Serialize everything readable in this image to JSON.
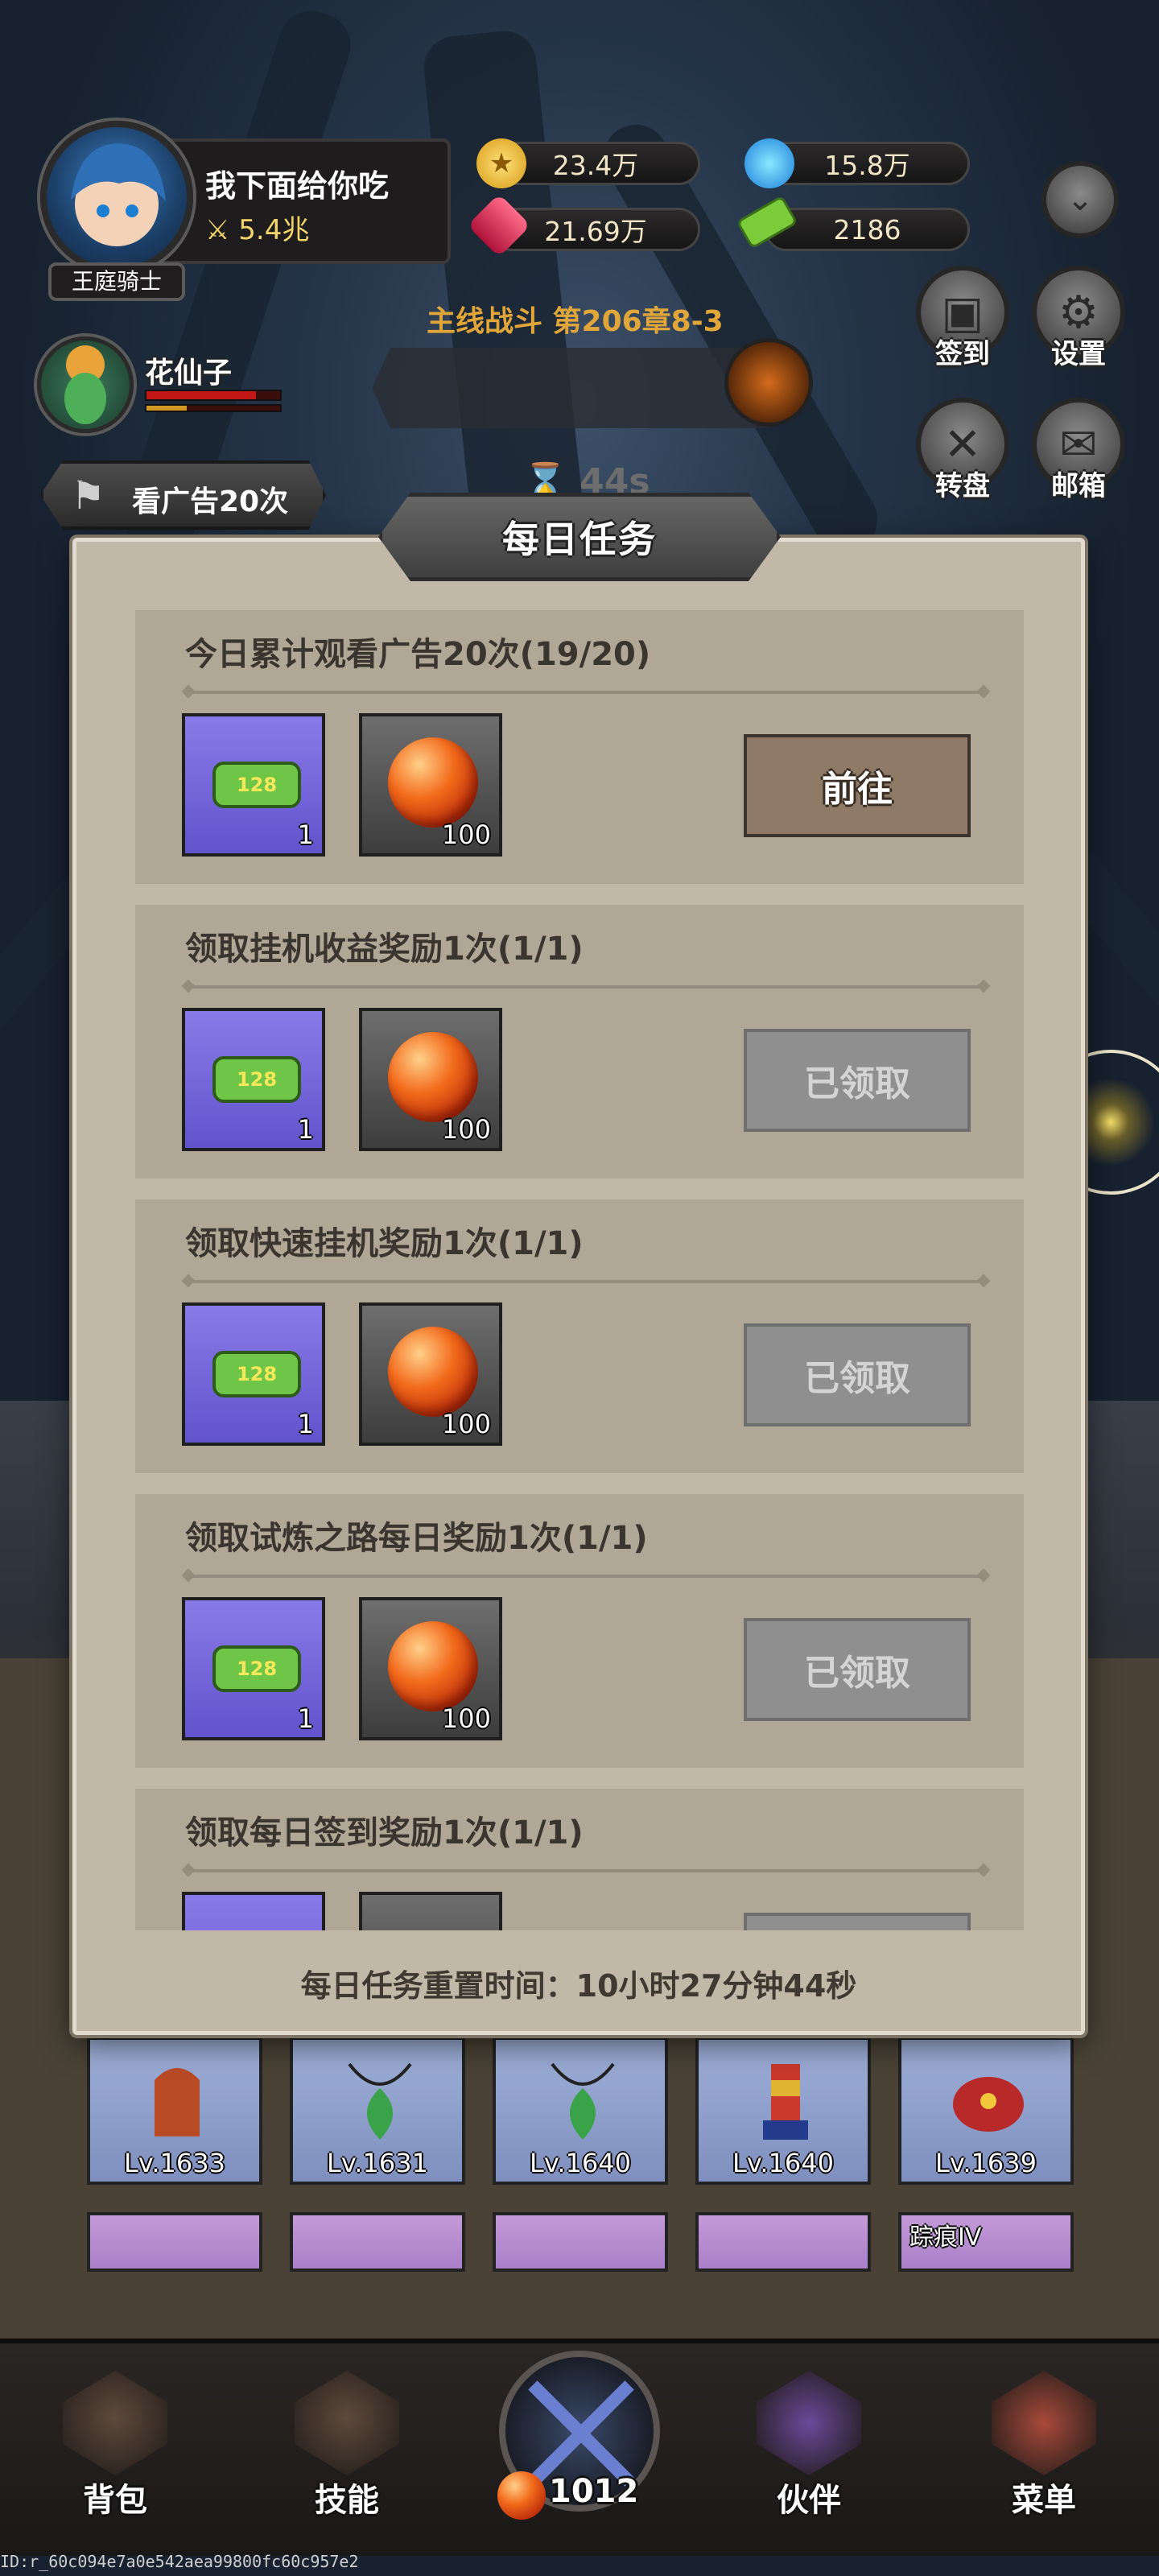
{
  "player": {
    "name": "我下面给你吃",
    "power": "5.4兆",
    "rank_title": "王庭骑士"
  },
  "resources": {
    "gold": "23.4万",
    "blue_gem": "15.8万",
    "red_gem": "21.69万",
    "ticket": "2186"
  },
  "companion": {
    "name": "花仙子"
  },
  "stage": {
    "label": "主线战斗 第206章8-3",
    "timer": "44s"
  },
  "ad_button": {
    "label": "看广告20次"
  },
  "side_menu": {
    "checkin": "签到",
    "settings": "设置",
    "wheel": "转盘",
    "mail": "邮箱"
  },
  "modal": {
    "title": "每日任务",
    "reset_time": "每日任务重置时间：10小时27分钟44秒",
    "tasks": [
      {
        "title": "今日累计观看广告20次(19/20)",
        "reward1_qty": "1",
        "reward2_qty": "100",
        "button": "前往",
        "status": "go"
      },
      {
        "title": "领取挂机收益奖励1次(1/1)",
        "reward1_qty": "1",
        "reward2_qty": "100",
        "button": "已领取",
        "status": "claimed"
      },
      {
        "title": "领取快速挂机奖励1次(1/1)",
        "reward1_qty": "1",
        "reward2_qty": "100",
        "button": "已领取",
        "status": "claimed"
      },
      {
        "title": "领取试炼之路每日奖励1次(1/1)",
        "reward1_qty": "1",
        "reward2_qty": "100",
        "button": "已领取",
        "status": "claimed"
      },
      {
        "title": "领取每日签到奖励1次(1/1)",
        "reward1_qty": "",
        "reward2_qty": "",
        "button": "",
        "status": "claimed"
      }
    ],
    "ticket_label": "128"
  },
  "equipment": [
    {
      "level": "Lv.1633"
    },
    {
      "level": "Lv.1631"
    },
    {
      "level": "Lv.1640"
    },
    {
      "level": "Lv.1640"
    },
    {
      "level": "Lv.1639"
    }
  ],
  "equipment_row2_tag": "踪痕IV",
  "nav": {
    "bag": "背包",
    "skills": "技能",
    "battle_count": "1012",
    "partner": "伙伴",
    "menu": "菜单"
  },
  "debug_id": "ID:r_60c094e7a0e542aea99800fc60c957e2",
  "icons": {
    "gold": "gold-coin-icon",
    "blue_gem": "blue-crystal-icon",
    "red_gem": "red-ruby-icon",
    "ticket": "green-ticket-icon"
  }
}
